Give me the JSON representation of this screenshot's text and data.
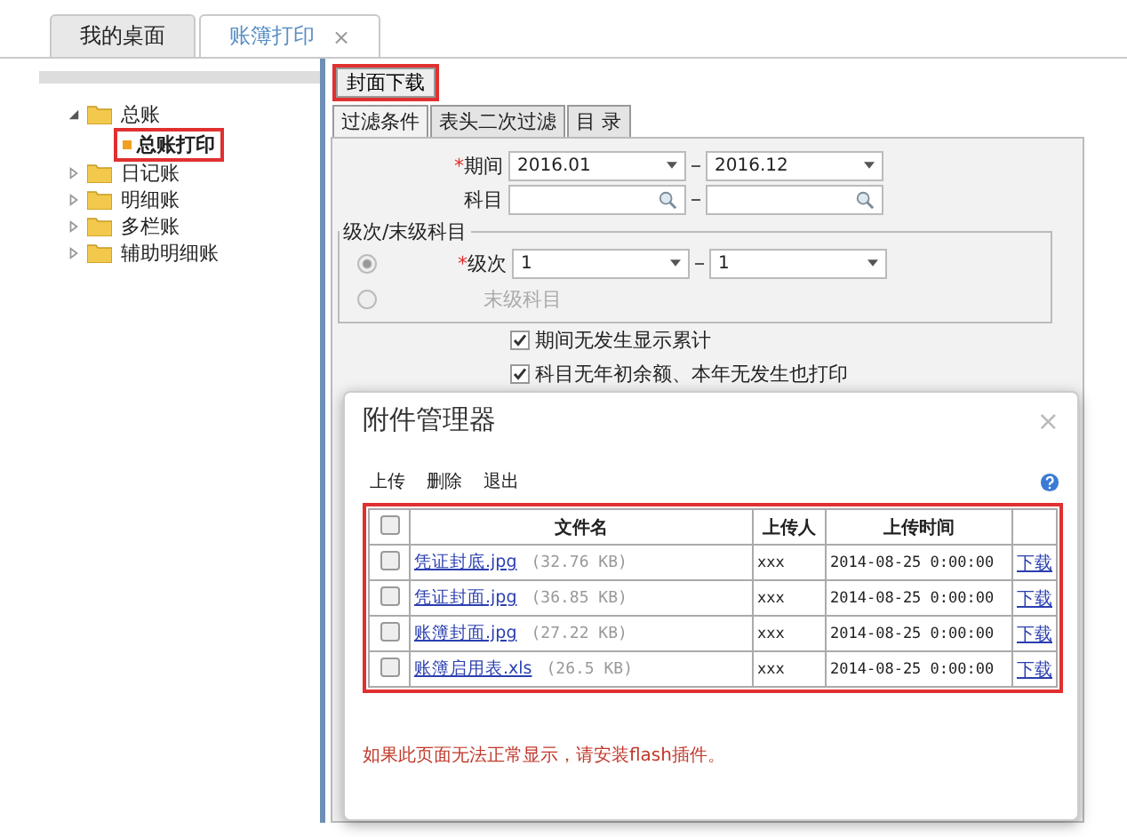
{
  "tabs": [
    {
      "label": "我的桌面",
      "selected": false
    },
    {
      "label": "账簿打印",
      "selected": true,
      "close": "×"
    }
  ],
  "tree": [
    {
      "label": "总账",
      "expanded": true,
      "highlighted": false,
      "children": [
        {
          "label": "总账打印",
          "highlighted": true
        }
      ]
    },
    {
      "label": "日记账",
      "expanded": false,
      "highlighted": false
    },
    {
      "label": "明细账",
      "expanded": false,
      "highlighted": false
    },
    {
      "label": "多栏账",
      "expanded": false,
      "highlighted": false
    },
    {
      "label": "辅助明细账",
      "expanded": false,
      "highlighted": false
    }
  ],
  "cover_download_button": {
    "label": "封面下载",
    "highlighted": true
  },
  "sub_tabs": [
    {
      "label": "过滤条件",
      "selected": true
    },
    {
      "label": "表头二次过滤",
      "selected": false
    },
    {
      "label": "目 录",
      "selected": false
    }
  ],
  "filter": {
    "period": {
      "mark": "*",
      "label": "期间",
      "from": "2016.01",
      "to": "2016.12"
    },
    "subject": {
      "label": "科目"
    },
    "level_group": {
      "title": "级次/末级科目",
      "options": [
        {
          "kind": "range",
          "label": "级次",
          "selected": true,
          "mark": "*",
          "from": "1",
          "to": "1"
        },
        {
          "kind": "plain",
          "label": "末级科目",
          "selected": false
        }
      ]
    },
    "checkboxes": [
      {
        "label": "期间无发生显示累计",
        "checked": true
      },
      {
        "label": "科目无年初余额、本年无发生也打印",
        "checked": true
      }
    ]
  },
  "dialog": {
    "title": "附件管理器",
    "close": "×",
    "toolbar": [
      "上传",
      "删除",
      "退出"
    ],
    "all_checked": false,
    "columns": [
      "文件名",
      "上传人",
      "上传时间"
    ],
    "rows": [
      {
        "file": "凭证封底.jpg",
        "size": "(32.76 KB)",
        "uploader": "xxx",
        "time": "2014-08-25 0:00:00",
        "action": "下载",
        "checked": false
      },
      {
        "file": "凭证封面.jpg",
        "size": "(36.85 KB)",
        "uploader": "xxx",
        "time": "2014-08-25 0:00:00",
        "action": "下载",
        "checked": false
      },
      {
        "file": "账簿封面.jpg",
        "size": "(27.22 KB)",
        "uploader": "xxx",
        "time": "2014-08-25 0:00:00",
        "action": "下载",
        "checked": false
      },
      {
        "file": "账簿启用表.xls",
        "size": "(26.5 KB)",
        "uploader": "xxx",
        "time": "2014-08-25 0:00:00",
        "action": "下载",
        "checked": false
      }
    ],
    "notice": "如果此页面无法正常显示，请安装flash插件。"
  }
}
